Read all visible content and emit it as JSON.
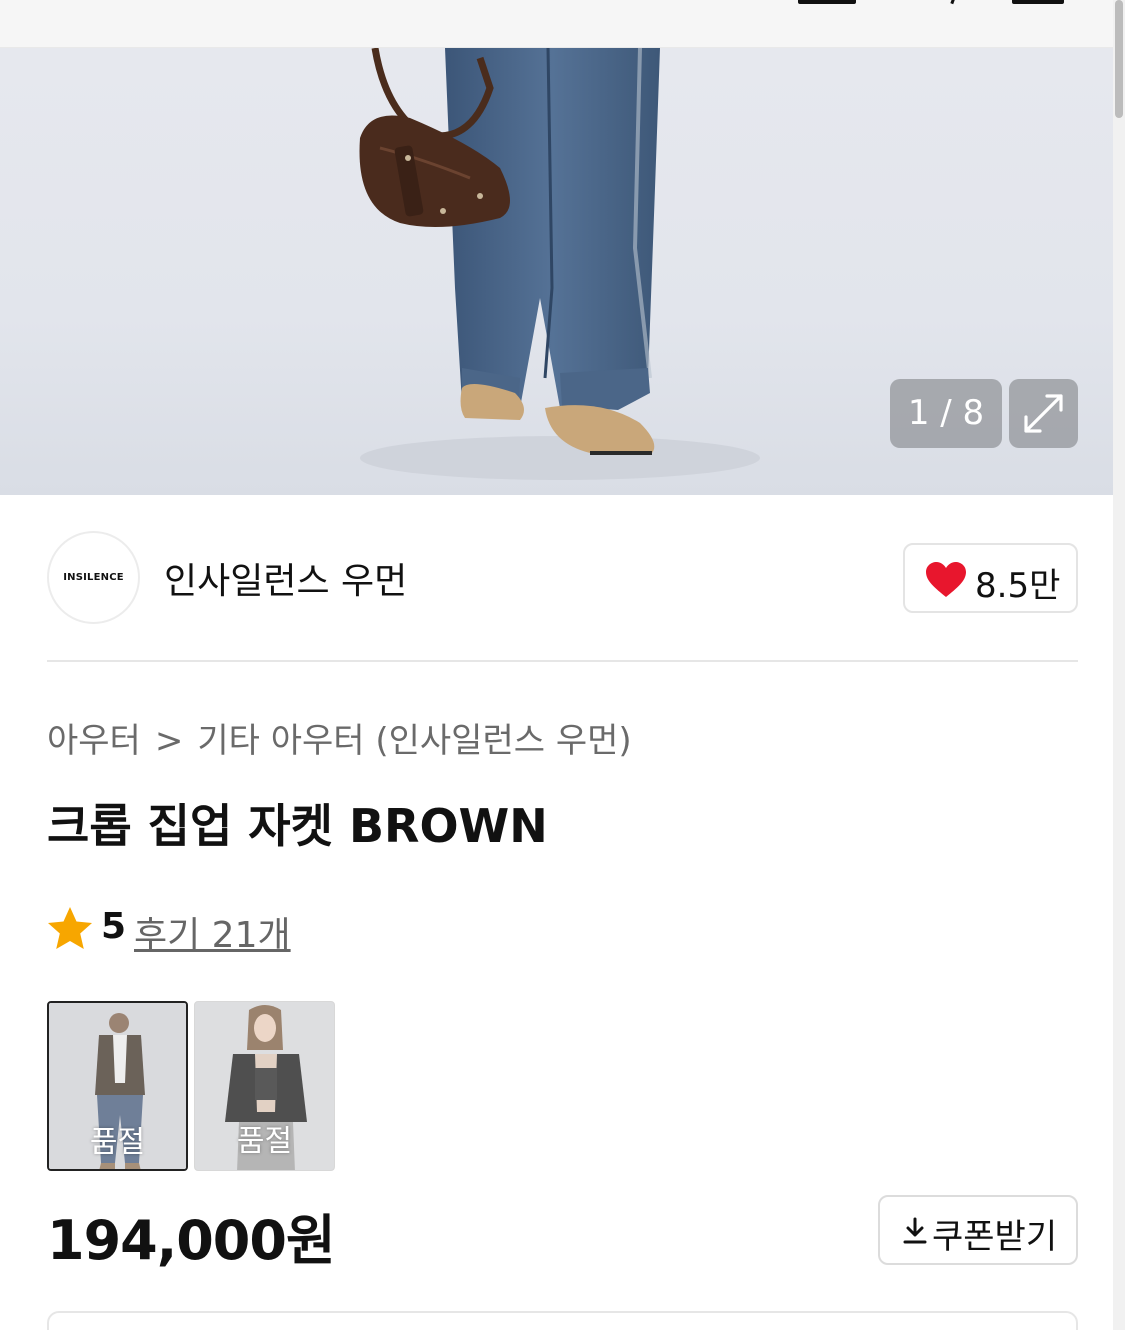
{
  "hero": {
    "counter_current": "1",
    "counter_total": "8",
    "counter_text": "1 / 8"
  },
  "brand": {
    "logo_text": "INSILENCE",
    "name": "인사일런스 우먼",
    "like_count": "8.5만"
  },
  "breadcrumb": {
    "items": [
      "아우터",
      "기타 아우터 (인사일런스 우먼)"
    ],
    "separator": ">"
  },
  "product": {
    "title": "크롭 집업 자켓 BROWN",
    "rating": "5",
    "review_link": "후기 21개",
    "price": "194,000원"
  },
  "options": [
    {
      "label": "품절",
      "selected": true
    },
    {
      "label": "품절",
      "selected": false
    }
  ],
  "coupon": {
    "label": "쿠폰받기"
  },
  "colors": {
    "heart": "#e8162d",
    "star": "#f7a600",
    "overlay": "#96989e"
  }
}
